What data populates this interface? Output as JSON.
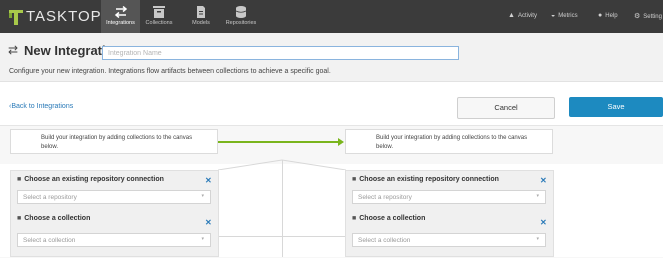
{
  "app": {
    "logo_text": "TASKTOP",
    "nav": [
      {
        "label": "Integrations",
        "icon": "arrows-icon",
        "active": true
      },
      {
        "label": "Collections",
        "icon": "collections-icon"
      },
      {
        "label": "Models",
        "icon": "models-icon"
      },
      {
        "label": "Repositories",
        "icon": "repositories-icon"
      }
    ],
    "right_nav": [
      {
        "label": "Activity",
        "icon": "bell-icon"
      },
      {
        "label": "Metrics",
        "icon": "dashboard-icon"
      },
      {
        "label": "Help",
        "icon": "help-icon"
      },
      {
        "label": "Setting",
        "icon": "gear-icon"
      }
    ]
  },
  "header": {
    "title": "New Integration",
    "name_placeholder": "Integration Name",
    "subtitle": "Configure your new integration. Integrations flow artifacts between collections to achieve a specific goal."
  },
  "actions": {
    "back_label": "Back to Integrations",
    "cancel_label": "Cancel",
    "save_label": "Save"
  },
  "canvas": {
    "hint_left": "Build your integration by adding collections to the canvas below.",
    "hint_right": "Build your integration by adding collections to the canvas below.",
    "connector_color": "#7ab51d",
    "panels": [
      {
        "repo_heading": "Choose an existing repository connection",
        "repo_placeholder": "Select a repository",
        "collection_heading": "Choose a collection",
        "collection_placeholder": "Select a collection"
      },
      {
        "repo_heading": "Choose an existing repository connection",
        "repo_placeholder": "Select a repository",
        "collection_heading": "Choose a collection",
        "collection_placeholder": "Select a collection"
      }
    ]
  },
  "colors": {
    "topbar": "#3b3b3b",
    "accent": "#1d8ac0",
    "link": "#2a7ab8"
  }
}
